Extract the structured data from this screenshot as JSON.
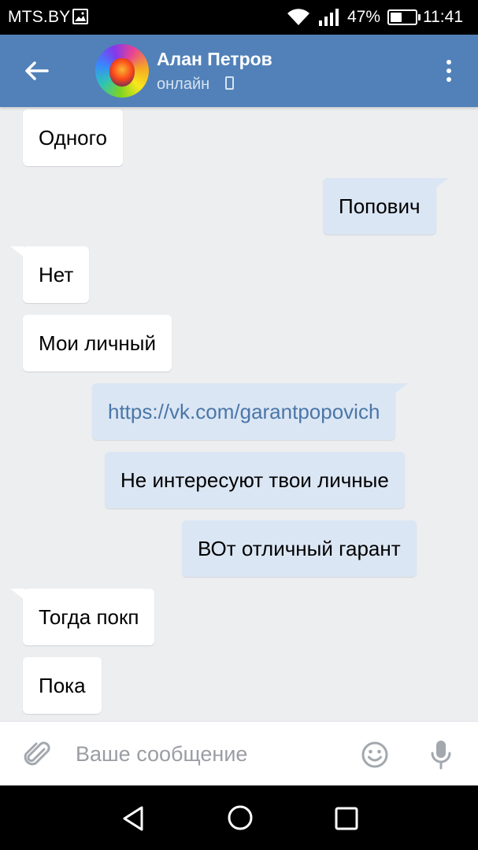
{
  "status_bar": {
    "carrier": "MTS.BY",
    "battery_percent": "47%",
    "battery_level": 0.47,
    "time": "11:41",
    "icons": [
      "photo-icon",
      "wifi-icon",
      "signal-icon",
      "battery-icon"
    ]
  },
  "header": {
    "contact_name": "Алан Петров",
    "status": "онлайн",
    "accent_color": "#5181b8",
    "icons": [
      "back-arrow-icon",
      "phone-icon",
      "more-vertical-icon"
    ]
  },
  "messages": [
    {
      "direction": "in",
      "text": "Одного"
    },
    {
      "direction": "out",
      "text": "Попович"
    },
    {
      "direction": "in",
      "text": "Нет"
    },
    {
      "direction": "in",
      "text": "Мои личный"
    },
    {
      "direction": "out",
      "text": "https://vk.com/garantpopovich",
      "is_link": true
    },
    {
      "direction": "out",
      "text": "Не интересуют твои личные"
    },
    {
      "direction": "out",
      "text": "ВОт отличный гарант"
    },
    {
      "direction": "in",
      "text": "Тогда покп"
    },
    {
      "direction": "in",
      "text": "Пока"
    }
  ],
  "composer": {
    "placeholder": "Ваше сообщение",
    "value": "",
    "icons": [
      "paperclip-icon",
      "emoji-icon",
      "microphone-icon"
    ]
  },
  "nav_bar": {
    "icons": [
      "nav-back-icon",
      "nav-home-icon",
      "nav-recents-icon"
    ]
  },
  "colors": {
    "incoming_bubble": "#ffffff",
    "outgoing_bubble": "#dbe6f4",
    "link": "#4a76a8",
    "chat_background": "#edeef0"
  }
}
